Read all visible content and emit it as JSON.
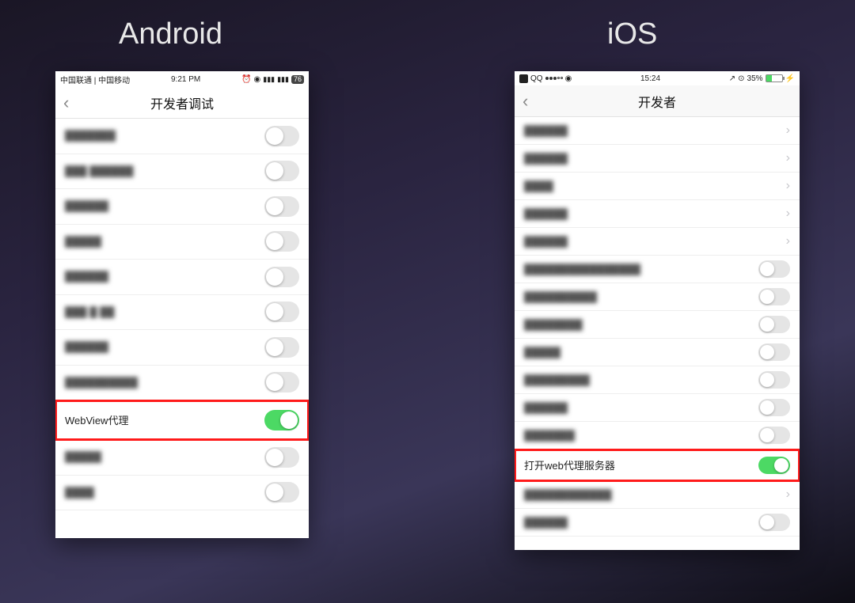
{
  "labels": {
    "android": "Android",
    "ios": "iOS"
  },
  "android": {
    "status": {
      "carrier": "中国联通 | 中国移动",
      "time": "9:21 PM",
      "battery": "76"
    },
    "title": "开发者调试",
    "rows": [
      {
        "label": "███████",
        "type": "toggle",
        "on": false,
        "blur": true
      },
      {
        "label": "███ ██████",
        "type": "toggle",
        "on": false,
        "blur": true
      },
      {
        "label": "██████",
        "type": "toggle",
        "on": false,
        "blur": true
      },
      {
        "label": "█████",
        "type": "toggle",
        "on": false,
        "blur": true
      },
      {
        "label": "██████",
        "type": "toggle",
        "on": false,
        "blur": true
      },
      {
        "label": "███ █ ██",
        "type": "toggle",
        "on": false,
        "blur": true
      },
      {
        "label": "██████",
        "type": "toggle",
        "on": false,
        "blur": true
      },
      {
        "label": "██████████",
        "type": "toggle",
        "on": false,
        "blur": true
      },
      {
        "label": "WebView代理",
        "type": "toggle",
        "on": true,
        "blur": false,
        "highlight": true
      },
      {
        "label": "█████",
        "type": "toggle",
        "on": false,
        "blur": true
      },
      {
        "label": "████",
        "type": "toggle",
        "on": false,
        "blur": true
      }
    ]
  },
  "ios": {
    "status": {
      "app": "QQ",
      "time": "15:24",
      "battery": "35%"
    },
    "title": "开发者",
    "rows": [
      {
        "label": "██████",
        "type": "link",
        "blur": true
      },
      {
        "label": "██████",
        "type": "link",
        "blur": true
      },
      {
        "label": "████",
        "type": "link",
        "blur": true
      },
      {
        "label": "██████",
        "type": "link",
        "blur": true
      },
      {
        "label": "██████",
        "type": "link",
        "blur": true
      },
      {
        "label": "████████████████",
        "type": "toggle",
        "on": false,
        "blur": true
      },
      {
        "label": "██████████",
        "type": "toggle",
        "on": false,
        "blur": true
      },
      {
        "label": "████████",
        "type": "toggle",
        "on": false,
        "blur": true
      },
      {
        "label": "█████",
        "type": "toggle",
        "on": false,
        "blur": true
      },
      {
        "label": "█████████",
        "type": "toggle",
        "on": false,
        "blur": true
      },
      {
        "label": "██████",
        "type": "toggle",
        "on": false,
        "blur": true
      },
      {
        "label": "███████",
        "type": "toggle",
        "on": false,
        "blur": true
      },
      {
        "label": "打开web代理服务器",
        "type": "toggle",
        "on": true,
        "blur": false,
        "highlight": true
      },
      {
        "label": "████████████",
        "type": "link",
        "blur": true
      },
      {
        "label": "██████",
        "type": "toggle",
        "on": false,
        "blur": true
      }
    ]
  }
}
